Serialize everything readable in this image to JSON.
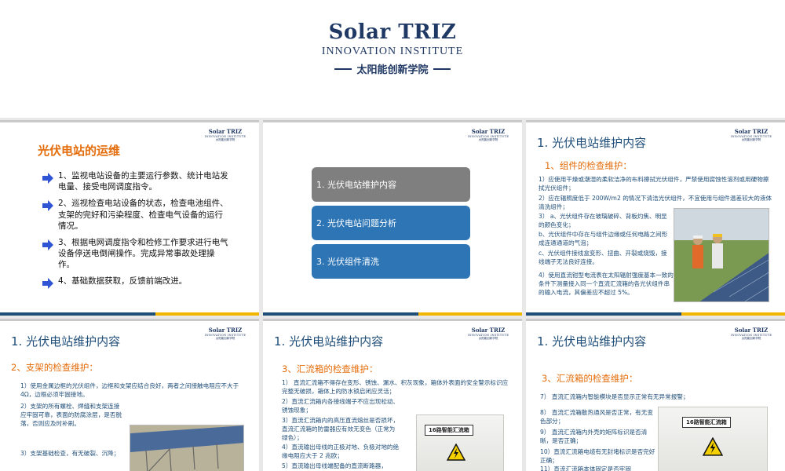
{
  "header": {
    "logo_main": "Solar TRIZ",
    "logo_sub": "INNOVATION INSTITUTE",
    "logo_cn": "太阳能创新学院"
  },
  "mini_logo": {
    "main": "Solar TRIZ",
    "sub": "INNOVATION INSTITUTE",
    "cn": "太阳能创新学院"
  },
  "colors": {
    "navy": "#1f4e79",
    "orange": "#e46c0a",
    "gray_btn": "#7f7f7f",
    "blue_btn": "#2e75b6"
  },
  "slide1": {
    "title": "光伏电站的运维",
    "items": [
      "1、监视电站设备的主要运行参数、统计电站发电量、接受电网调度指令。",
      "2、巡视检查电站设备的状态，检查电池组件、支架的完好和污染程度、检查电气设备的运行情况。",
      "3、根据电网调度指令和检修工作要求进行电气设备停送电倒闸操作。完成异常事故处理操作。",
      "4、基础数据获取，反馈前端改进。"
    ]
  },
  "slide2": {
    "menu": [
      "1. 光伏电站维护内容",
      "2. 光伏电站问题分析",
      "3. 光伏组件清洗"
    ]
  },
  "slide3": {
    "title": "1. 光伏电站维护内容",
    "sub": "1、组件的检查维护：",
    "p1": "1）应使用干燥或潮湿的柔软洁净的布料擦拭光伏组件，严禁使用腐蚀性溶剂或用硬物擦拭光伏组件；",
    "p2": "2）应在辐照度低于 200W/m2 的情况下清洁光伏组件，不宜使用与组件温差较大的液体清洗组件；",
    "p3a": "3） a、光伏组件存在玻璃破碎、背板灼焦、明显的颜色变化；",
    "p3b": "b、光伏组件中存在与组件边缘或任何电路之间形成连通通道的气泡；",
    "p3c": "c、光伏组件接线盒变形、扭曲、开裂或烧毁，接线端子无法良好连接。",
    "p4": "4）使用直流钳型电流表在太阳辐射强度基本一致的条件下测量接入同一个直流汇流箱的各光伏组件串的输入电流，其偏差应不超过 5%。"
  },
  "slide4": {
    "title": "1. 光伏电站维护内容",
    "sub": "2、支架的检查维护：",
    "p1": "1）使用金属边框的光伏组件，边框和支架应结合良好，两者之间接触电阻应不大于 4Ω，边框必须牢固接地。",
    "p2": "2）支架的所有螺栓、焊缝和支架连接应牢固可靠，表面的防腐涂层，是否脱落，否则应及时补刷。",
    "p3": "3）支架基础检查，有无破裂、沉降；"
  },
  "slide5": {
    "title": "1. 光伏电站维护内容",
    "sub": "3、汇流箱的检查维护：",
    "p1": "1） 直流汇流箱不得存在变形、锈蚀、漏水、积灰现象，箱体外表面的安全警示标识应完整无破损，箱体上的防水锁启闭应灵活；",
    "p2": "2）直流汇流箱内各接线端子不应出现松动、锈蚀现象；",
    "p3": "3）直流汇流箱内的高压直流熔丝是否损坏，直流汇流箱的防雷器应有效无变色（正常为绿色）；",
    "p4": "4）直流输出母线的正极对地、负极对地的绝缘电阻应大于 2 兆欧；",
    "p5": "5）直流输出母线端配备的直流断路器，",
    "box_label": "16路智能汇流箱"
  },
  "slide6": {
    "title": "1. 光伏电站维护内容",
    "sub": "3、汇流箱的检查维护：",
    "p7": "7） 直流汇流箱内智能模块是否显示正常有无异常报警；",
    "p8": "8） 直流汇流箱散热通风是否正常，有无变色部分；",
    "p9": "9） 直流汇流箱内外壳的矩阵标识是否清晰，是否正确；",
    "p10": "10）直流汇流箱电缆有无封堵标识是否完好正确；",
    "p11": "11）直流汇流箱本体固定是否牢固",
    "box_label": "16路智能汇流箱"
  }
}
